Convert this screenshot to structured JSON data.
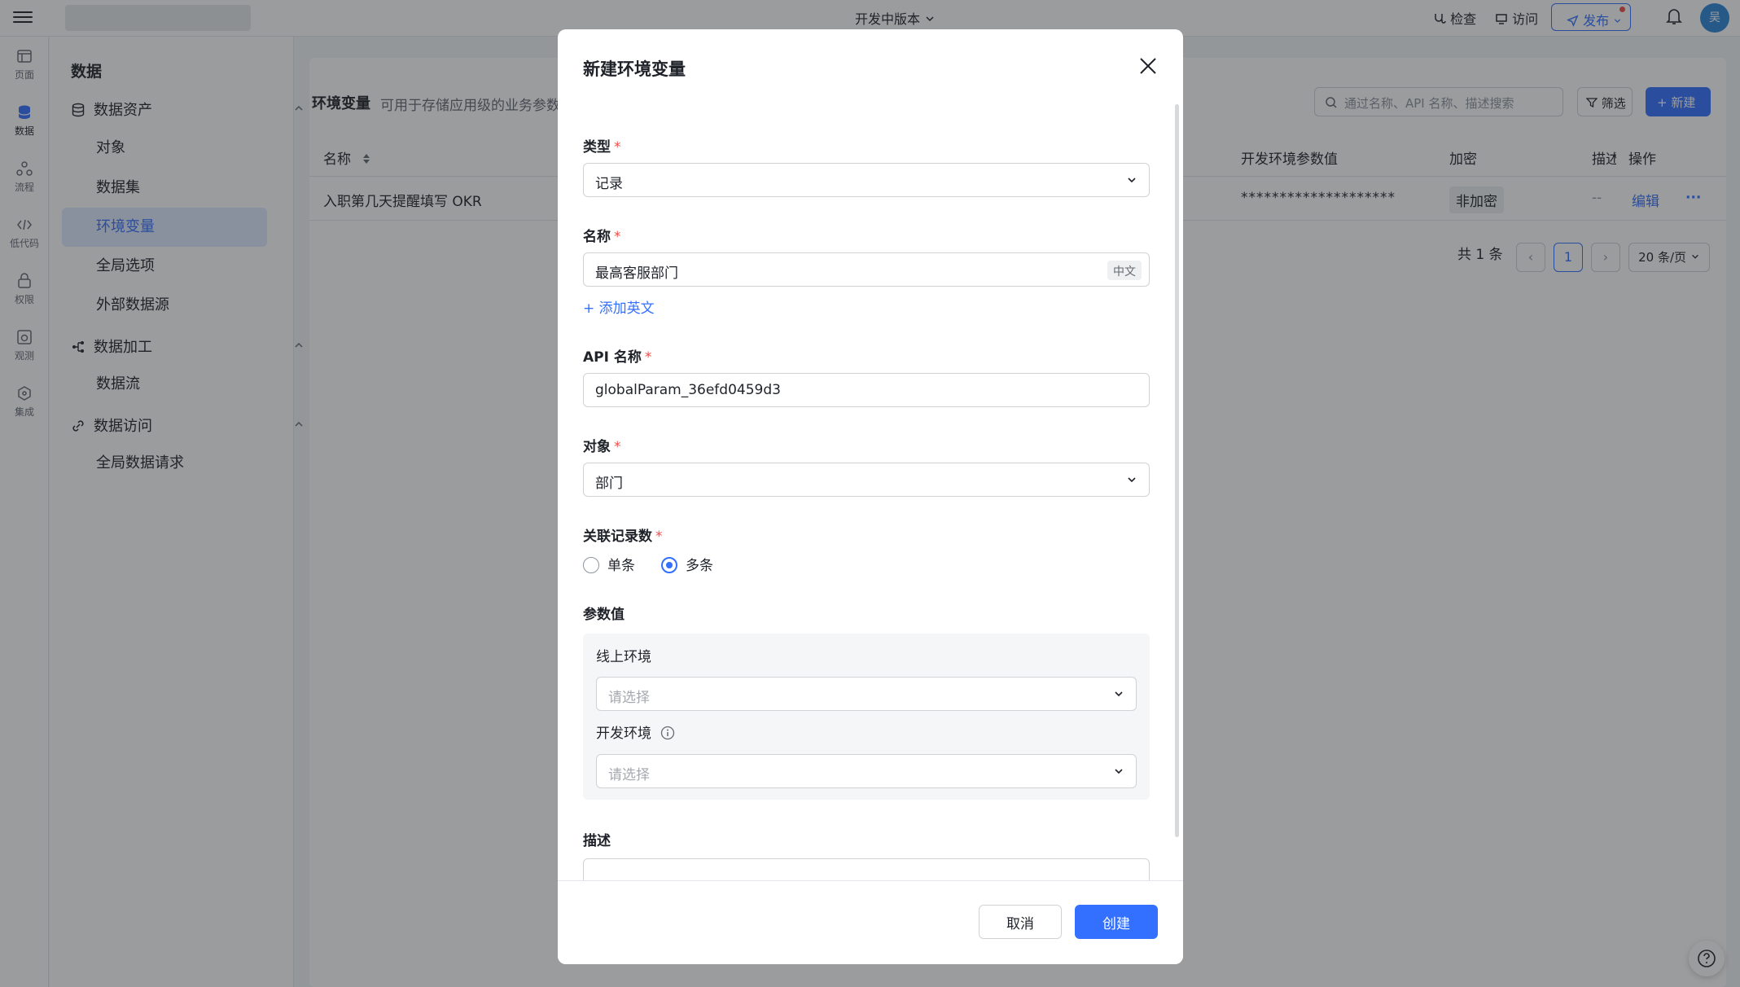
{
  "topbar": {
    "version": "开发中版本",
    "check": "检查",
    "visit": "访问",
    "publish": "发布",
    "avatar_text": "吴"
  },
  "rail": {
    "items": [
      {
        "label": "页面",
        "icon": "page-icon"
      },
      {
        "label": "数据",
        "icon": "database-icon"
      },
      {
        "label": "流程",
        "icon": "flow-icon"
      },
      {
        "label": "低代码",
        "icon": "code-icon"
      },
      {
        "label": "权限",
        "icon": "lock-icon"
      },
      {
        "label": "观测",
        "icon": "monitor-icon"
      },
      {
        "label": "集成",
        "icon": "hexagon-icon"
      }
    ]
  },
  "sidebar": {
    "title": "数据",
    "group_assets": "数据资产",
    "item_object": "对象",
    "item_dataset": "数据集",
    "item_envvar": "环境变量",
    "item_global_options": "全局选项",
    "item_external_source": "外部数据源",
    "group_processing": "数据加工",
    "item_dataflow": "数据流",
    "group_access": "数据访问",
    "item_global_request": "全局数据请求"
  },
  "content": {
    "title": "环境变量",
    "description": "可用于存储应用级的业务参数",
    "search_placeholder": "通过名称、API 名称、描述搜索",
    "filter": "筛选",
    "new": "+ 新建",
    "columns": {
      "name": "名称",
      "dev_value": "开发环境参数值",
      "encrypt": "加密",
      "desc": "描述",
      "ops": "操作"
    },
    "row": {
      "name": "入职第几天提醒填写 OKR",
      "dev_value": "********************",
      "encrypt": "非加密",
      "desc": "--",
      "edit": "编辑",
      "more": "···"
    },
    "pager": {
      "total": "共 1 条",
      "page": "1",
      "page_size": "20 条/页"
    }
  },
  "modal": {
    "title": "新建环境变量",
    "type_label": "类型",
    "type_value": "记录",
    "name_label": "名称",
    "name_value": "最高客服部门",
    "name_lang": "中文",
    "add_english": "+ 添加英文",
    "api_label": "API 名称",
    "api_value": "globalParam_36efd0459d3",
    "object_label": "对象",
    "object_value": "部门",
    "count_label": "关联记录数",
    "count_single": "单条",
    "count_multi": "多条",
    "count_selected": "多条",
    "param_label": "参数值",
    "online_env_label": "线上环境",
    "online_env_placeholder": "请选择",
    "dev_env_label": "开发环境",
    "dev_env_placeholder": "请选择",
    "desc_label": "描述",
    "cancel": "取消",
    "create": "创建"
  },
  "colors": {
    "primary": "#3370ff",
    "required": "#f54a45"
  }
}
